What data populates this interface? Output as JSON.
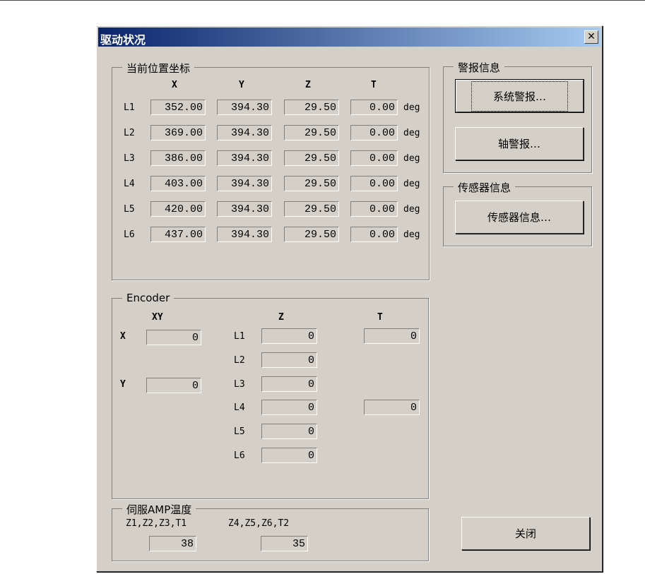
{
  "window": {
    "title": "驱动状况",
    "close": "✕"
  },
  "position": {
    "caption": "当前位置坐标",
    "columns": [
      "X",
      "Y",
      "Z",
      "T"
    ],
    "unit": "deg",
    "rows": [
      {
        "label": "L1",
        "x": "352.00",
        "y": "394.30",
        "z": "29.50",
        "t": "0.00"
      },
      {
        "label": "L2",
        "x": "369.00",
        "y": "394.30",
        "z": "29.50",
        "t": "0.00"
      },
      {
        "label": "L3",
        "x": "386.00",
        "y": "394.30",
        "z": "29.50",
        "t": "0.00"
      },
      {
        "label": "L4",
        "x": "403.00",
        "y": "394.30",
        "z": "29.50",
        "t": "0.00"
      },
      {
        "label": "L5",
        "x": "420.00",
        "y": "394.30",
        "z": "29.50",
        "t": "0.00"
      },
      {
        "label": "L6",
        "x": "437.00",
        "y": "394.30",
        "z": "29.50",
        "t": "0.00"
      }
    ]
  },
  "alarm": {
    "caption": "警报信息",
    "system_button": "系统警报…",
    "axis_button": "轴警报…"
  },
  "sensor": {
    "caption": "传感器信息",
    "button": "传感器信息…"
  },
  "encoder": {
    "caption": "Encoder",
    "xy_header": "XY",
    "z_header": "Z",
    "t_header": "T",
    "x_label": "X",
    "x_value": "0",
    "y_label": "Y",
    "y_value": "0",
    "z_rows": [
      {
        "label": "L1",
        "value": "0"
      },
      {
        "label": "L2",
        "value": "0"
      },
      {
        "label": "L3",
        "value": "0"
      },
      {
        "label": "L4",
        "value": "0"
      },
      {
        "label": "L5",
        "value": "0"
      },
      {
        "label": "L6",
        "value": "0"
      }
    ],
    "t_values": [
      "0",
      "0"
    ]
  },
  "temp": {
    "caption": "伺服AMP温度",
    "label1": "Z1,Z2,Z3,T1",
    "value1": "38",
    "label2": "Z4,Z5,Z6,T2",
    "value2": "35"
  },
  "close_button": "关闭"
}
